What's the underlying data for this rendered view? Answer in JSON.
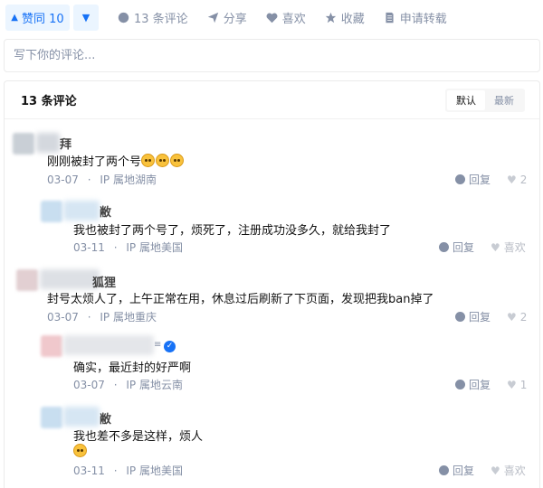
{
  "actions": {
    "vote_up_label": "赞同 10",
    "comment_label": "13 条评论",
    "share_label": "分享",
    "like_label": "喜欢",
    "favorite_label": "收藏",
    "reprint_label": "申请转载"
  },
  "comment_input": {
    "placeholder": "写下你的评论..."
  },
  "comments_panel": {
    "title": "13 条评论",
    "sort_default": "默认",
    "sort_latest": "最新"
  },
  "comments": [
    {
      "name_tail": "拜",
      "text": "刚刚被封了两个号",
      "date": "03-07",
      "location": "IP 属地湖南",
      "reply": "回复",
      "likes": "2"
    },
    {
      "name_tail": "敝",
      "text": "我也被封了两个号了，烦死了，注册成功没多久，就给我封了",
      "date": "03-11",
      "location": "IP 属地美国",
      "reply": "回复",
      "likes": "喜欢"
    },
    {
      "name_tail": "狐狸",
      "text": "封号太烦人了，上午正常在用，休息过后刷新了下页面，发现把我ban掉了",
      "date": "03-07",
      "location": "IP 属地重庆",
      "reply": "回复",
      "likes": "2"
    },
    {
      "name_tail": "",
      "text": "确实，最近封的好严啊",
      "date": "03-07",
      "location": "IP 属地云南",
      "reply": "回复",
      "likes": "1"
    },
    {
      "name_tail": "敝",
      "text": "我也差不多是这样，烦人",
      "date": "03-11",
      "location": "IP 属地美国",
      "reply": "回复",
      "likes": "喜欢"
    }
  ],
  "separator": "·",
  "colors": {
    "accent": "#1772f6",
    "muted": "#8590a6",
    "vote_bg": "#ebf5ff"
  }
}
